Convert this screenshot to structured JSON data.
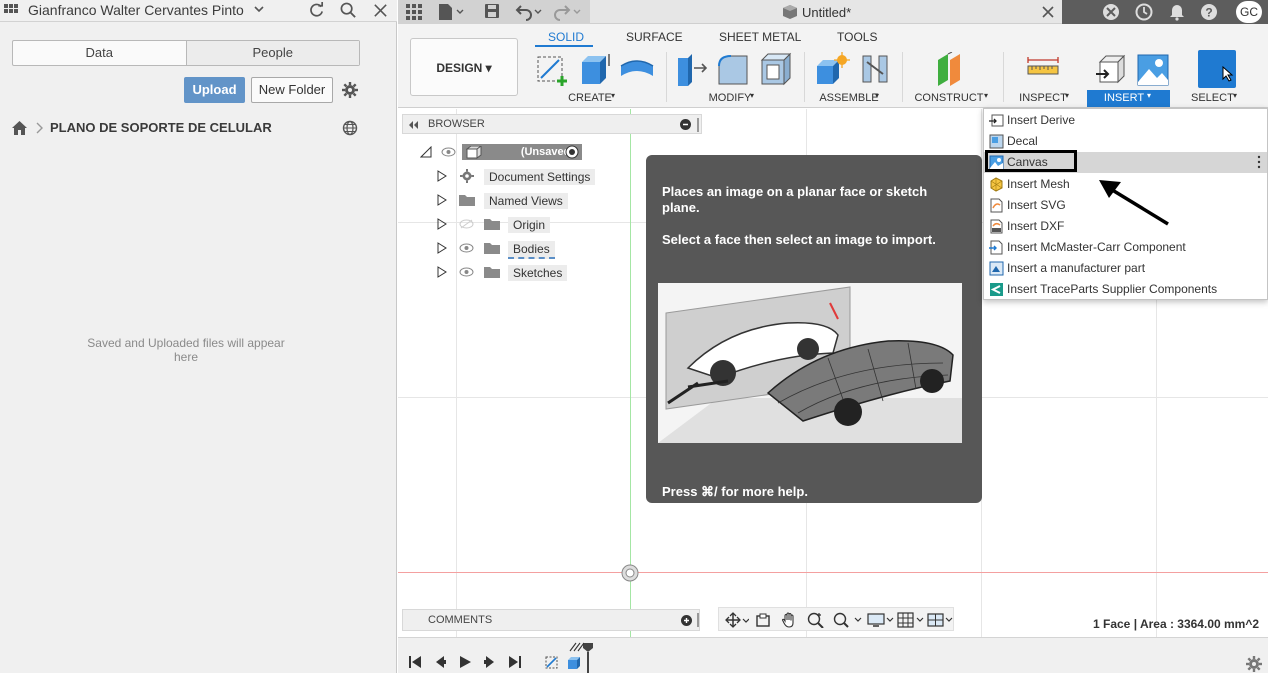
{
  "data_panel": {
    "user_name": "Gianfranco Walter Cervantes Pinto",
    "tabs": [
      "Data",
      "People"
    ],
    "upload_label": "Upload",
    "new_folder_label": "New Folder",
    "breadcrumb_project": "PLANO DE SOPORTE DE CELULAR",
    "empty_message": "Saved and Uploaded files will appear here"
  },
  "document": {
    "title": "Untitled*",
    "user_initials": "GC"
  },
  "toolbar": {
    "workspace": "DESIGN",
    "tabs": [
      "SOLID",
      "SURFACE",
      "SHEET METAL",
      "TOOLS"
    ],
    "active_tab": "SOLID",
    "groups": [
      "CREATE",
      "MODIFY",
      "ASSEMBLE",
      "CONSTRUCT",
      "INSPECT",
      "INSERT",
      "SELECT"
    ],
    "active_group": "INSERT"
  },
  "browser": {
    "title": "BROWSER",
    "root_label": "(Unsaved)",
    "items": [
      {
        "label": "Document Settings",
        "icon": "gear-icon"
      },
      {
        "label": "Named Views",
        "icon": "folder-icon"
      },
      {
        "label": "Origin",
        "icon": "folder-icon",
        "visibility": "hidden"
      },
      {
        "label": "Bodies",
        "icon": "folder-icon",
        "visibility": "visible"
      },
      {
        "label": "Sketches",
        "icon": "folder-icon",
        "visibility": "visible"
      }
    ]
  },
  "tooltip": {
    "description": "Places an image on a planar face or sketch plane.",
    "instruction": "Select a face then select an image to import.",
    "help": "Press ⌘/ for more help."
  },
  "insert_menu": {
    "items": [
      {
        "label": "Insert Derive",
        "icon": "derive-icon"
      },
      {
        "label": "Decal",
        "icon": "decal-icon"
      },
      {
        "label": "Canvas",
        "icon": "canvas-icon",
        "highlighted": true
      },
      {
        "label": "Insert Mesh",
        "icon": "mesh-icon"
      },
      {
        "label": "Insert SVG",
        "icon": "svg-icon"
      },
      {
        "label": "Insert DXF",
        "icon": "dxf-icon"
      },
      {
        "label": "Insert McMaster-Carr Component",
        "icon": "mcmaster-icon"
      },
      {
        "label": "Insert a manufacturer part",
        "icon": "manufacturer-icon"
      },
      {
        "label": "Insert TraceParts Supplier Components",
        "icon": "traceparts-icon"
      }
    ]
  },
  "comments": {
    "title": "COMMENTS"
  },
  "status": {
    "selection": "1 Face | Area : 3364.00 mm^2"
  },
  "colors": {
    "accent": "#1f7ad1",
    "upload_button": "#6294c8",
    "tooltip_bg": "#575757",
    "x_axis": "#f28b8b",
    "y_axis": "#8ee68e"
  }
}
